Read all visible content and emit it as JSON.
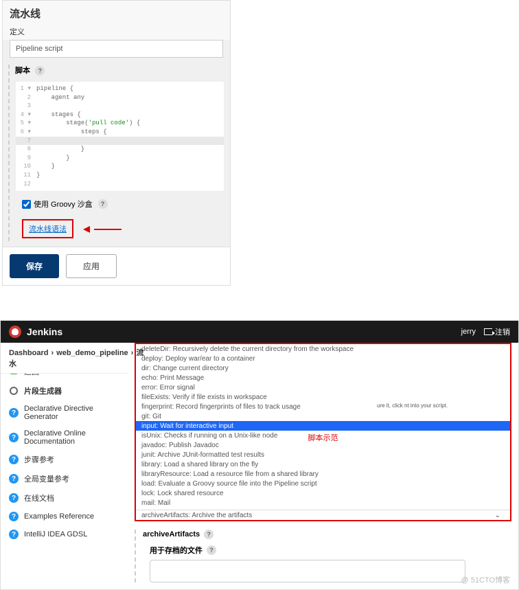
{
  "pipeline": {
    "title": "流水线",
    "definition_label": "定义",
    "definition_value": "Pipeline script",
    "script_label": "脚本",
    "code_lines": [
      {
        "n": "1",
        "marker": "▾",
        "text": "pipeline {"
      },
      {
        "n": "2",
        "marker": "",
        "text": "    agent any"
      },
      {
        "n": "3",
        "marker": "",
        "text": ""
      },
      {
        "n": "4",
        "marker": "▾",
        "text": "    stages {"
      },
      {
        "n": "5",
        "marker": "▾",
        "text": "        stage('pull code') {"
      },
      {
        "n": "6",
        "marker": "▾",
        "text": "            steps {"
      },
      {
        "n": "7",
        "marker": "",
        "text": ""
      },
      {
        "n": "8",
        "marker": "",
        "text": "            }"
      },
      {
        "n": "9",
        "marker": "",
        "text": "        }"
      },
      {
        "n": "10",
        "marker": "",
        "text": "    }"
      },
      {
        "n": "11",
        "marker": "",
        "text": "}"
      },
      {
        "n": "12",
        "marker": "",
        "text": ""
      }
    ],
    "groovy_sandbox": "使用 Groovy 沙盒",
    "syntax_link": "流水线语法",
    "save_btn": "保存",
    "apply_btn": "应用"
  },
  "jenkins": {
    "title": "Jenkins",
    "user": "jerry",
    "logout": "注销",
    "breadcrumb": [
      "Dashboard",
      "web_demo_pipeline",
      "流水"
    ],
    "sidebar": [
      {
        "icon": "up",
        "label": "返回"
      },
      {
        "icon": "gear",
        "label": "片段生成器",
        "bold": true
      },
      {
        "icon": "q",
        "label": "Declarative Directive Generator"
      },
      {
        "icon": "q",
        "label": "Declarative Online Documentation"
      },
      {
        "icon": "q",
        "label": "步骤参考"
      },
      {
        "icon": "q",
        "label": "全局变量参考"
      },
      {
        "icon": "q",
        "label": "在线文档"
      },
      {
        "icon": "q",
        "label": "Examples Reference"
      },
      {
        "icon": "q",
        "label": "IntelliJ IDEA GDSL"
      }
    ],
    "truncated_text": "ure it, click nt into your script.",
    "dropdown_items": [
      "deleteDir: Recursively delete the current directory from the workspace",
      "deploy: Deploy war/ear to a container",
      "dir: Change current directory",
      "echo: Print Message",
      "error: Error signal",
      "fileExists: Verify if file exists in workspace",
      "fingerprint: Record fingerprints of files to track usage",
      "git: Git",
      "input: Wait for interactive input",
      "isUnix: Checks if running on a Unix-like node",
      "javadoc: Publish Javadoc",
      "junit: Archive JUnit-formatted test results",
      "library: Load a shared library on the fly",
      "libraryResource: Load a resource file from a shared library",
      "load: Evaluate a Groovy source file into the Pipeline script",
      "lock: Lock shared resource",
      "mail: Mail"
    ],
    "dropdown_annotation": "脚本示范",
    "dropdown_footer": "archiveArtifacts: Archive the artifacts",
    "form": {
      "step_label": "archiveArtifacts",
      "file_label": "用于存档的文件"
    },
    "watermark": "@ 51CTO博客"
  }
}
